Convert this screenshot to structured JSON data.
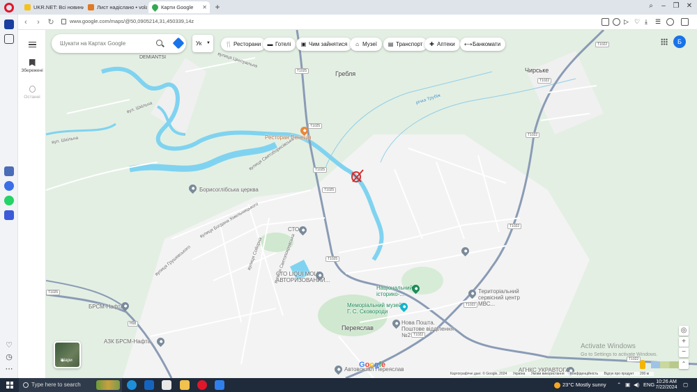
{
  "browser": {
    "tabs": [
      {
        "label": "UKR.NET: Всі новини Украї",
        "active": false
      },
      {
        "label": "Лист надіслано • volandr",
        "active": false
      },
      {
        "label": "Карти Google",
        "active": true
      }
    ],
    "url": "www.google.com/maps/@50,0905214,31,450339,14z"
  },
  "maps": {
    "search_placeholder": "Шукати на Картах Google",
    "language_chip": "Ук",
    "categories": [
      "Ресторани",
      "Готелі",
      "Чим зайнятися",
      "Музеї",
      "Транспорт",
      "Аптеки",
      "Банкомати"
    ],
    "account_initial": "Б",
    "rail": {
      "saved": "Збережені",
      "recent": "Останні"
    },
    "layers_label": "Шари",
    "google": "Google",
    "attribution": [
      "Картографічні дані: © Google, 2024",
      "Україна",
      "Умови використання",
      "Конфіденційність",
      "Відгук про продукт",
      "200 м"
    ]
  },
  "map_labels": {
    "demiantsi": "DEMIANTSI",
    "hreblia": "Гребля",
    "chyrske": "Чирське",
    "restaurant": "Ресторан Венеція",
    "church": "Борисоглібська церква",
    "sto": "СТО",
    "sto_liqui": "СТО LIQUI MOLY АВТОРИЗОВАНИЙ...",
    "museum_hist": "Національний історико-...",
    "museum_skovoroda": "Меморіальний музей Г. С. Сковороди",
    "nova_poshta": "Нова Пошта. Поштове відділення №2",
    "pereiaslav": "Переяслав",
    "service_center": "Територіальний сервісний центр МВС...",
    "brsm": "БРСМ-Нафта",
    "azk_brsm": "АЗК БРСМ-Нафта",
    "agnks": "АГНКС УКРАВТОГАЗ",
    "avtovokzal": "Автовокзал Переяслав",
    "river_trubizh": "річка Трубіж",
    "street_shchilna": "вул. Шкільна",
    "street_shkilna2": "вул. Шкільна",
    "street_tsentralna": "вулиця Центральна",
    "street_sviatoborisivska": "вулиця Святоборисівська",
    "street_soborna": "вулиця Соборна",
    "street_sviatopokrovska": "вулиця Святопокровська",
    "street_hrushevskoho": "вулиця Грушевського",
    "street_bohdana": "вулиця Богдана Хмельницького"
  },
  "road_shields": [
    "T1025",
    "T1025",
    "T1025",
    "T1025",
    "T1025",
    "T1022",
    "T1022",
    "T1022",
    "T1022",
    "T1022",
    "T1022",
    "T1022",
    "H08",
    "T1025"
  ],
  "watermark": {
    "title": "Activate Windows",
    "sub": "Go to Settings to activate Windows."
  },
  "taskbar": {
    "search_placeholder": "Type here to search",
    "weather": "23°C  Mostly sunny",
    "lang": "ENG",
    "time": "10:26 AM",
    "date": "7/22/2024"
  },
  "colors": {
    "water": "#7fd3f0",
    "road": "#ffffff",
    "highway": "#8a9bb5",
    "urban": "#f4f4f4",
    "green": "#cfe8cf",
    "marker": "#d32f2f",
    "accent": "#1a73e8"
  },
  "icons": [
    "opera-icon",
    "search-icon",
    "directions-icon",
    "restaurant-icon",
    "hotel-icon",
    "camera-icon",
    "museum-icon",
    "transit-icon",
    "pharmacy-icon",
    "atm-icon",
    "apps-icon",
    "bookmark-icon",
    "history-icon",
    "layers-icon",
    "pegman-icon",
    "locate-icon",
    "zoom-in-icon",
    "zoom-out-icon",
    "windows-icon"
  ]
}
